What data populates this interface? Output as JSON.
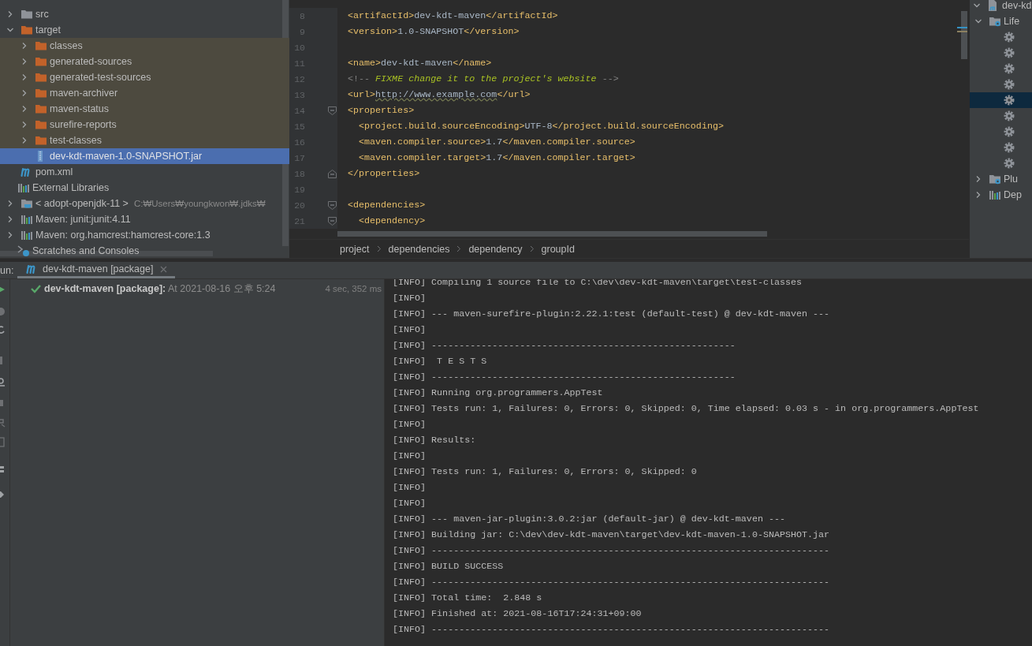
{
  "project_tree": {
    "items": [
      {
        "label": "src",
        "kind": "folder",
        "expanded": false,
        "selected": false
      },
      {
        "label": "target",
        "kind": "excluded-folder",
        "expanded": true,
        "selected": false,
        "children": [
          {
            "label": "classes",
            "kind": "excluded-folder",
            "expanded": false,
            "selected": false
          },
          {
            "label": "generated-sources",
            "kind": "excluded-folder",
            "expanded": false,
            "selected": false
          },
          {
            "label": "generated-test-sources",
            "kind": "excluded-folder",
            "expanded": false,
            "selected": false
          },
          {
            "label": "maven-archiver",
            "kind": "excluded-folder",
            "expanded": false,
            "selected": false
          },
          {
            "label": "maven-status",
            "kind": "excluded-folder",
            "expanded": false,
            "selected": false
          },
          {
            "label": "surefire-reports",
            "kind": "excluded-folder",
            "expanded": false,
            "selected": false
          },
          {
            "label": "test-classes",
            "kind": "excluded-folder",
            "expanded": false,
            "selected": false
          },
          {
            "label": "dev-kdt-maven-1.0-SNAPSHOT.jar",
            "kind": "jar",
            "selected": true
          }
        ]
      },
      {
        "label": "pom.xml",
        "kind": "maven",
        "selected": false
      }
    ],
    "libraries": {
      "label": "External Libraries",
      "selected": false,
      "children": [
        {
          "label": "< adopt-openjdk-11 >",
          "detail": "C:₩Users₩youngkwon₩.jdks₩",
          "kind": "jdk",
          "expanded": false,
          "selected": false
        },
        {
          "label": "Maven: junit:junit:4.11",
          "kind": "library",
          "expanded": false,
          "selected": false
        },
        {
          "label": "Maven: org.hamcrest:hamcrest-core:1.3",
          "kind": "library",
          "expanded": false,
          "selected": false
        }
      ]
    },
    "scratches": {
      "label": "Scratches and Consoles",
      "selected": false
    }
  },
  "editor": {
    "lines": [
      {
        "number": "8",
        "tokens": [
          {
            "kind": "tag",
            "text": "<artifactId>"
          },
          {
            "kind": "text",
            "text": "dev-kdt-maven"
          },
          {
            "kind": "tag",
            "text": "</artifactId>"
          }
        ]
      },
      {
        "number": "9",
        "tokens": [
          {
            "kind": "tag",
            "text": "<version>"
          },
          {
            "kind": "text",
            "text": "1.0-SNAPSHOT"
          },
          {
            "kind": "tag",
            "text": "</version>"
          }
        ]
      },
      {
        "number": "10"
      },
      {
        "number": "11",
        "tokens": [
          {
            "kind": "tag",
            "text": "<name>"
          },
          {
            "kind": "text",
            "text": "dev-kdt-maven"
          },
          {
            "kind": "tag",
            "text": "</name>"
          }
        ]
      },
      {
        "number": "12",
        "tokens": [
          {
            "kind": "comment",
            "text": "<!-- "
          },
          {
            "kind": "todo",
            "text": "FIXME change it to the project's website"
          },
          {
            "kind": "comment",
            "text": " -->"
          }
        ]
      },
      {
        "number": "13",
        "tokens": [
          {
            "kind": "tag",
            "text": "<url>"
          },
          {
            "kind": "url",
            "text": "http://www.example.com"
          },
          {
            "kind": "tag",
            "text": "</url>"
          }
        ]
      },
      {
        "number": "14",
        "fold_start": true,
        "tokens": [
          {
            "kind": "tag",
            "text": "<properties>"
          }
        ]
      },
      {
        "number": "15",
        "tokens": [
          {
            "kind": "tag",
            "text": "  <project.build.sourceEncoding>"
          },
          {
            "kind": "text",
            "text": "UTF-8"
          },
          {
            "kind": "tag",
            "text": "</project.build.sourceEncoding>"
          }
        ]
      },
      {
        "number": "16",
        "tokens": [
          {
            "kind": "tag",
            "text": "  <maven.compiler.source>"
          },
          {
            "kind": "text",
            "text": "1.7"
          },
          {
            "kind": "tag",
            "text": "</maven.compiler.source>"
          }
        ]
      },
      {
        "number": "17",
        "tokens": [
          {
            "kind": "tag",
            "text": "  <maven.compiler.target>"
          },
          {
            "kind": "text",
            "text": "1.7"
          },
          {
            "kind": "tag",
            "text": "</maven.compiler.target>"
          }
        ]
      },
      {
        "number": "18",
        "fold_end": true,
        "tokens": [
          {
            "kind": "tag",
            "text": "</properties>"
          }
        ]
      },
      {
        "number": "19"
      },
      {
        "number": "20",
        "fold_start": true,
        "tokens": [
          {
            "kind": "tag",
            "text": "<dependencies>"
          }
        ]
      },
      {
        "number": "21",
        "fold_start": true,
        "tokens": [
          {
            "kind": "tag",
            "text": "  <dependency>"
          }
        ]
      }
    ],
    "breadcrumbs": [
      "project",
      "dependencies",
      "dependency",
      "groupId"
    ]
  },
  "maven_panel": {
    "items": [
      {
        "label": "dev-kd",
        "kind": "pom",
        "expanded": true,
        "selected": false,
        "children": [
          {
            "label": "Life",
            "kind": "gear-folder",
            "expanded": true,
            "selected": false,
            "children": [
              {
                "kind": "goal",
                "selected": false
              },
              {
                "kind": "goal",
                "selected": false
              },
              {
                "kind": "goal",
                "selected": false
              },
              {
                "kind": "goal",
                "selected": false
              },
              {
                "kind": "goal",
                "selected": true
              },
              {
                "kind": "goal",
                "selected": false
              },
              {
                "kind": "goal",
                "selected": false
              },
              {
                "kind": "goal",
                "selected": false
              },
              {
                "kind": "goal",
                "selected": false
              }
            ]
          },
          {
            "label": "Plu",
            "kind": "gear-folder",
            "expanded": false,
            "selected": false
          },
          {
            "label": "Dep",
            "kind": "library",
            "expanded": false,
            "selected": false
          }
        ]
      }
    ]
  },
  "run_panel": {
    "label": "un:",
    "tabs": [
      {
        "label": "dev-kdt-maven [package]",
        "selected": true
      }
    ],
    "tree": [
      {
        "passed": true,
        "title": "**dev-kdt-maven [package]:** At 2021-08-16 오후 5:24",
        "duration": "4 sec, 352 ms"
      }
    ],
    "console": [
      "[INFO] Compiling 1 source file to C:\\dev\\dev-kdt-maven\\target\\test-classes",
      "[INFO]",
      "[INFO] --- maven-surefire-plugin:2.22.1:test (default-test) @ dev-kdt-maven ---",
      "[INFO]",
      "[INFO] -------------------------------------------------------",
      "[INFO]  T E S T S",
      "[INFO] -------------------------------------------------------",
      "[INFO] Running org.programmers.AppTest",
      "[INFO] Tests run: 1, Failures: 0, Errors: 0, Skipped: 0, Time elapsed: 0.03 s - in org.programmers.AppTest",
      "[INFO]",
      "[INFO] Results:",
      "[INFO]",
      "[INFO] Tests run: 1, Failures: 0, Errors: 0, Skipped: 0",
      "[INFO]",
      "[INFO]",
      "[INFO] --- maven-jar-plugin:3.0.2:jar (default-jar) @ dev-kdt-maven ---",
      "[INFO] Building jar: C:\\dev\\dev-kdt-maven\\target\\dev-kdt-maven-1.0-SNAPSHOT.jar",
      "[INFO] ------------------------------------------------------------------------",
      "[INFO] BUILD SUCCESS",
      "[INFO] ------------------------------------------------------------------------",
      "[INFO] Total time:  2.848 s",
      "[INFO] Finished at: 2021-08-16T17:24:31+09:00",
      "[INFO] ------------------------------------------------------------------------"
    ]
  }
}
